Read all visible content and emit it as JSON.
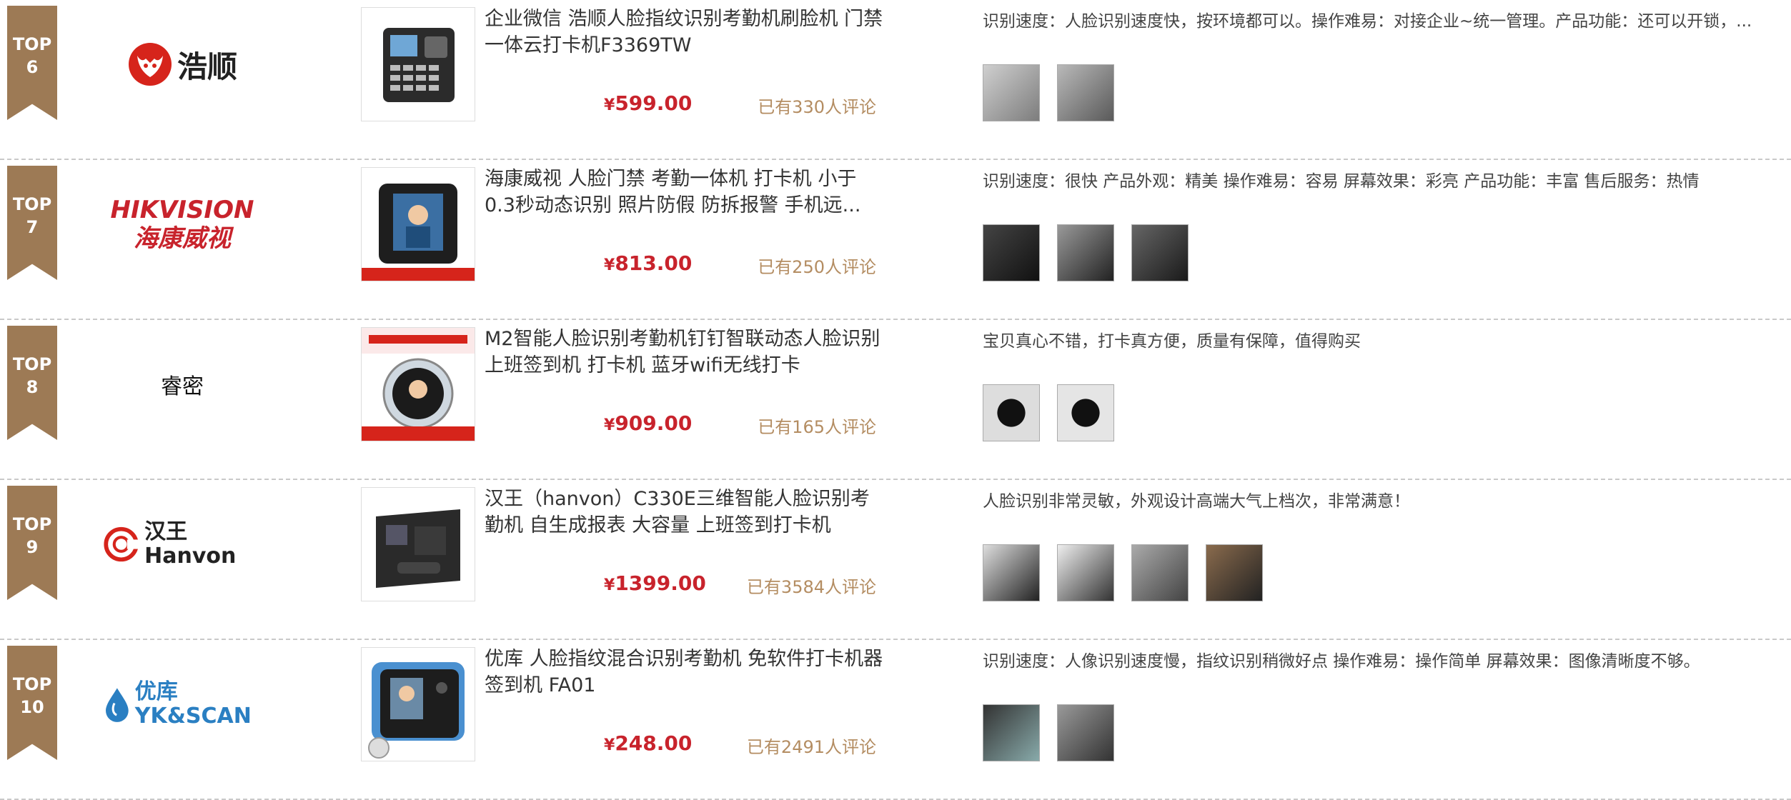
{
  "rows": [
    {
      "rank_top": "TOP",
      "rank_num": "6",
      "brand": "浩顺",
      "title": "企业微信 浩顺人脸指纹识别考勤机刷脸机 门禁一体云打卡机F3369TW",
      "price_symbol": "¥",
      "price": "599.00",
      "count": "已有330人评论",
      "review": "识别速度：人脸识别速度快，按环境都可以。操作难易：对接企业~统一管理。产品功能：还可以开锁，...",
      "photos": 2,
      "logo_color": "#d6241b"
    },
    {
      "rank_top": "TOP",
      "rank_num": "7",
      "brand": "HIKVISION 海康威视",
      "title": "海康威视 人脸门禁 考勤一体机 打卡机 小于0.3秒动态识别 照片防假 防拆报警 手机远...",
      "price_symbol": "¥",
      "price": "813.00",
      "count": "已有250人评论",
      "review": "识别速度：很快 产品外观：精美 操作难易：容易 屏幕效果：彩亮 产品功能：丰富 售后服务：热情",
      "photos": 3,
      "logo_color": "#c8232c"
    },
    {
      "rank_top": "TOP",
      "rank_num": "8",
      "brand": "睿密",
      "title": "M2智能人脸识别考勤机钉钉智联动态人脸识别 上班签到机 打卡机 蓝牙wifi无线打卡",
      "price_symbol": "¥",
      "price": "909.00",
      "count": "已有165人评论",
      "review": "宝贝真心不错，打卡真方便，质量有保障，值得购买",
      "photos": 2,
      "logo_color": "#111111"
    },
    {
      "rank_top": "TOP",
      "rank_num": "9",
      "brand": "汉王 Hanvon",
      "title": "汉王（hanvon）C330E三维智能人脸识别考勤机 自生成报表 大容量 上班签到打卡机",
      "price_symbol": "¥",
      "price": "1399.00",
      "count": "已有3584人评论",
      "review": "人脸识别非常灵敏，外观设计高端大气上档次，非常满意！",
      "photos": 4,
      "logo_color": "#d6241b"
    },
    {
      "rank_top": "TOP",
      "rank_num": "10",
      "brand": "优库 YK&SCAN",
      "title": "优库 人脸指纹混合识别考勤机 免软件打卡机器签到机 FA01",
      "price_symbol": "¥",
      "price": "248.00",
      "count": "已有2491人评论",
      "review": "识别速度：人像识别速度慢，指纹识别稍微好点 操作难易：操作简单 屏幕效果：图像清晰度不够。",
      "photos": 2,
      "logo_color": "#2a7fc2"
    }
  ]
}
